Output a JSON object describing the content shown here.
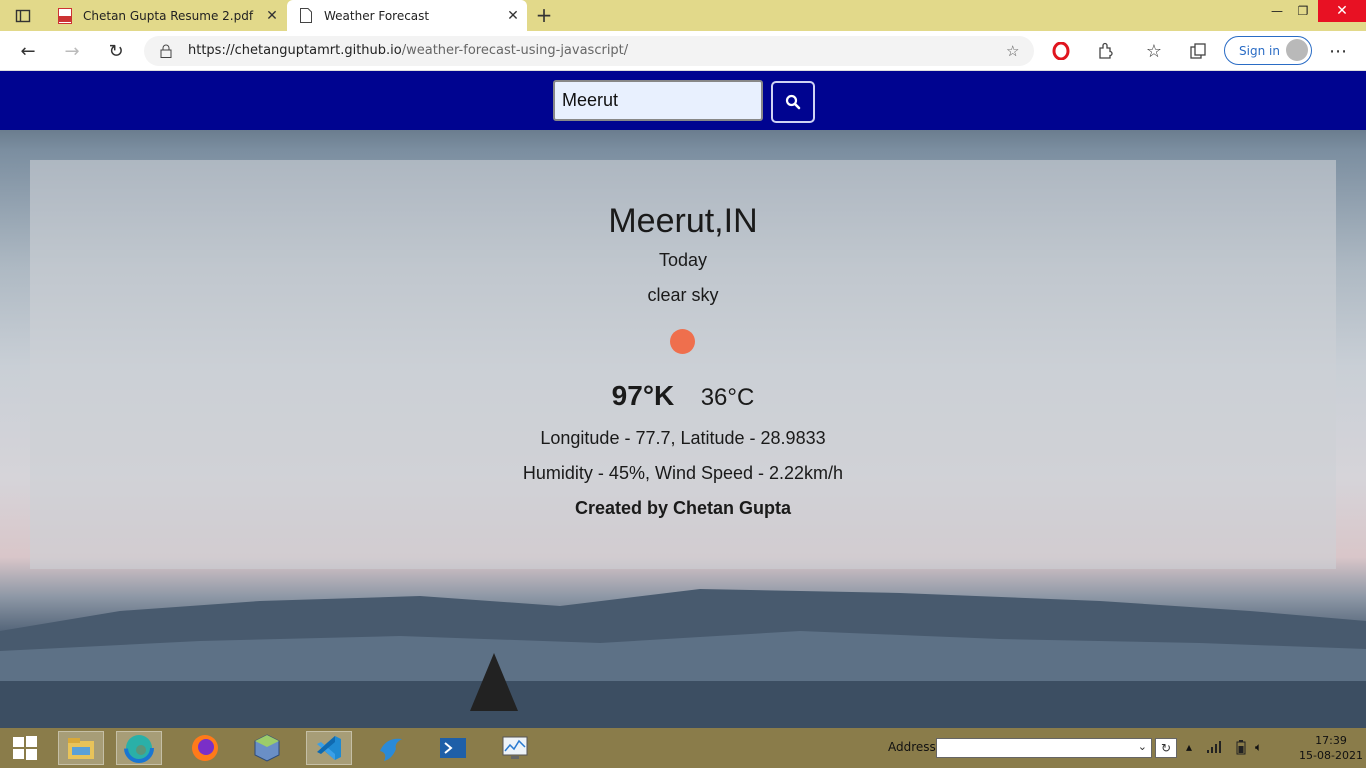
{
  "browser": {
    "tabs": [
      {
        "title": "Chetan Gupta Resume 2.pdf",
        "icon": "pdf-icon"
      },
      {
        "title": "Weather Forecast",
        "icon": "page-icon"
      }
    ],
    "url_host": "https://chetanguptamrt.github.io",
    "url_path": "/weather-forecast-using-javascript/",
    "signin_label": "Sign in"
  },
  "search": {
    "value": "Meerut"
  },
  "weather": {
    "city": "Meerut,IN",
    "day": "Today",
    "description": "clear sky",
    "temp_k": "97°K",
    "temp_c": "36°C",
    "coords": "Longitude - 77.7, Latitude - 28.9833",
    "humidity": "Humidity - 45%, Wind Speed - 2.22km/h",
    "credit": "Created by Chetan Gupta",
    "sun_color": "#ef6f4d"
  },
  "taskbar": {
    "address_label": "Address",
    "time": "17:39",
    "date": "15-08-2021"
  },
  "colors": {
    "header": "#000490",
    "tabbar": "#e2d98a",
    "taskbar": "#8a7c4a"
  }
}
